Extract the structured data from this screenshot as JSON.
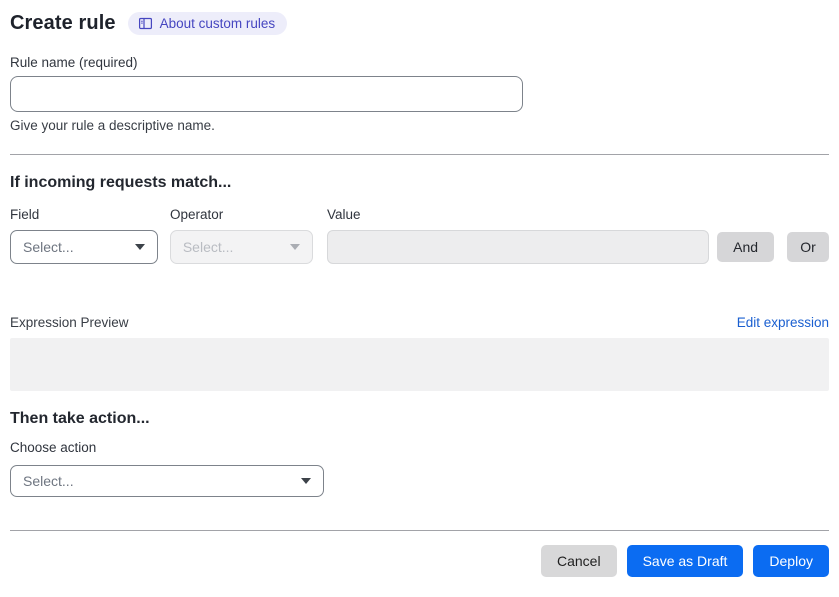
{
  "header": {
    "title": "Create rule",
    "about_badge": {
      "label": "About custom rules",
      "icon": "book-icon"
    }
  },
  "rule_name": {
    "label": "Rule name (required)",
    "value": "",
    "helper": "Give your rule a descriptive name."
  },
  "match_section": {
    "heading": "If incoming requests match...",
    "columns": {
      "field": "Field",
      "operator": "Operator",
      "value": "Value"
    },
    "field_select": {
      "value": "Select...",
      "state": "enabled"
    },
    "operator_select": {
      "value": "Select...",
      "state": "disabled"
    },
    "value_input": {
      "value": "",
      "state": "disabled"
    },
    "and_button": "And",
    "or_button": "Or"
  },
  "expression_preview": {
    "label": "Expression Preview",
    "edit_link": "Edit expression",
    "content": ""
  },
  "action_section": {
    "heading": "Then take action...",
    "label": "Choose action",
    "action_select": {
      "value": "Select..."
    }
  },
  "footer": {
    "cancel": "Cancel",
    "save_draft": "Save as Draft",
    "deploy": "Deploy"
  },
  "colors": {
    "primary_button": "#0b6cf2",
    "link": "#1a5fd0",
    "badge_bg": "#ededfa",
    "badge_text": "#4646c0",
    "disabled_bg": "#f3f3f4",
    "preview_bg": "#f1f1f2"
  }
}
